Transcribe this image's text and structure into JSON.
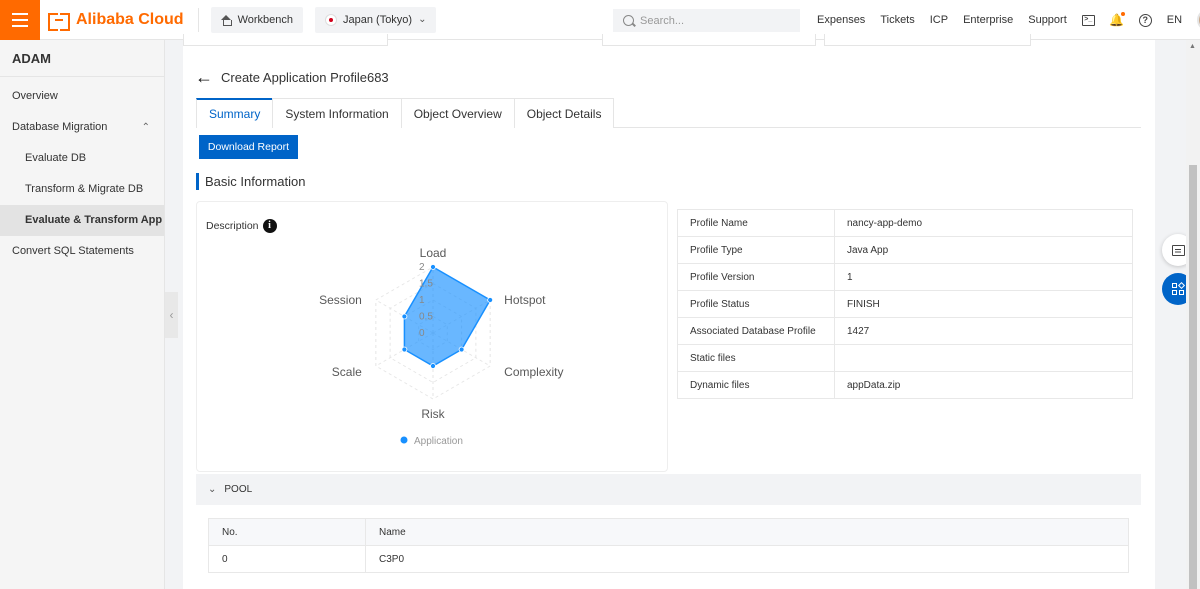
{
  "topbar": {
    "brand": "Alibaba Cloud",
    "workbench": "Workbench",
    "region": "Japan (Tokyo)",
    "search_placeholder": "Search...",
    "links": [
      "Expenses",
      "Tickets",
      "ICP",
      "Enterprise",
      "Support"
    ],
    "language": "EN"
  },
  "sidebar": {
    "title": "ADAM",
    "items": [
      {
        "label": "Overview"
      },
      {
        "label": "Database Migration"
      },
      {
        "label": "Evaluate DB"
      },
      {
        "label": "Transform & Migrate DB"
      },
      {
        "label": "Evaluate & Transform App"
      },
      {
        "label": "Convert SQL Statements"
      }
    ]
  },
  "page": {
    "title": "Create Application Profile683",
    "tabs": [
      "Summary",
      "System Information",
      "Object Overview",
      "Object Details"
    ],
    "download_button": "Download Report",
    "section_title": "Basic Information",
    "description_label": "Description"
  },
  "chart_data": {
    "type": "radar",
    "axes": [
      "Load",
      "Hotspot",
      "Complexity",
      "Risk",
      "Scale",
      "Session"
    ],
    "ticks": [
      "0",
      "0.5",
      "1",
      "1.5",
      "2"
    ],
    "max": 2,
    "series": [
      {
        "name": "Application",
        "values": [
          2,
          2,
          1,
          1,
          1,
          1
        ],
        "color": "#1890ff"
      }
    ]
  },
  "profile_info": [
    {
      "label": "Profile Name",
      "value": "nancy-app-demo"
    },
    {
      "label": "Profile Type",
      "value": "Java App"
    },
    {
      "label": "Profile Version",
      "value": "1"
    },
    {
      "label": "Profile Status",
      "value": "FINISH"
    },
    {
      "label": "Associated Database Profile",
      "value": "1427"
    },
    {
      "label": "Static files",
      "value": ""
    },
    {
      "label": "Dynamic files",
      "value": "appData.zip"
    }
  ],
  "pool": {
    "title": "POOL",
    "columns": [
      "No.",
      "Name"
    ],
    "rows": [
      [
        "0",
        "C3P0"
      ]
    ]
  },
  "colors": {
    "accent": "#0064c8",
    "brand": "#ff6a00"
  }
}
